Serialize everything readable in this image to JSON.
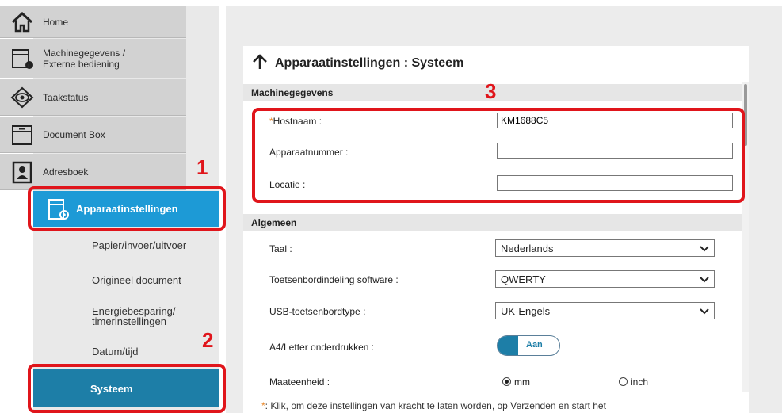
{
  "sidebar": {
    "items": [
      {
        "label": "Home",
        "icon": "home-icon"
      },
      {
        "label_line1": "Machinegegevens /",
        "label_line2": "Externe bediening",
        "icon": "machine-info-icon"
      },
      {
        "label": "Taakstatus",
        "icon": "eye-icon"
      },
      {
        "label": "Document Box",
        "icon": "document-box-icon"
      },
      {
        "label": "Adresboek",
        "icon": "addressbook-icon"
      }
    ],
    "active": {
      "label": "Apparaatinstellingen",
      "icon": "device-settings-icon"
    },
    "subitems": [
      {
        "label": "Papier/invoer/uitvoer"
      },
      {
        "label": "Origineel document"
      },
      {
        "label_line1": "Energiebesparing/",
        "label_line2": "timerinstellingen"
      },
      {
        "label": "Datum/tijd"
      }
    ],
    "selected_sub": {
      "label": "Systeem"
    }
  },
  "panel": {
    "title": "Apparaatinstellingen : Systeem",
    "sections": {
      "machine": {
        "heading": "Machinegegevens",
        "hostname": {
          "required_mark": "*",
          "label": "Hostnaam :",
          "value": "KM1688C5"
        },
        "device_number": {
          "label": "Apparaatnummer :",
          "value": ""
        },
        "location": {
          "label": "Locatie :",
          "value": ""
        }
      },
      "general": {
        "heading": "Algemeen",
        "language": {
          "label": "Taal :",
          "value": "Nederlands"
        },
        "keyboard_layout": {
          "label": "Toetsenbordindeling software :",
          "value": "QWERTY"
        },
        "usb_keyboard": {
          "label": "USB-toetsenbordtype :",
          "value": "UK-Engels"
        },
        "a4_letter": {
          "label": "A4/Letter onderdrukken :",
          "value": "Aan"
        },
        "units": {
          "label": "Maateenheid :",
          "option_mm": "mm",
          "option_inch": "inch",
          "selected": "mm"
        }
      }
    },
    "footnote_star": "*",
    "footnote": ": Klik, om deze instellingen van kracht te laten worden, op Verzenden en start het"
  },
  "callouts": {
    "n1": "1",
    "n2": "2",
    "n3": "3"
  },
  "colors": {
    "accent": "#1d9ad6",
    "selected": "#1d7ea7",
    "callout": "#e0151b",
    "required": "#e9882a"
  }
}
